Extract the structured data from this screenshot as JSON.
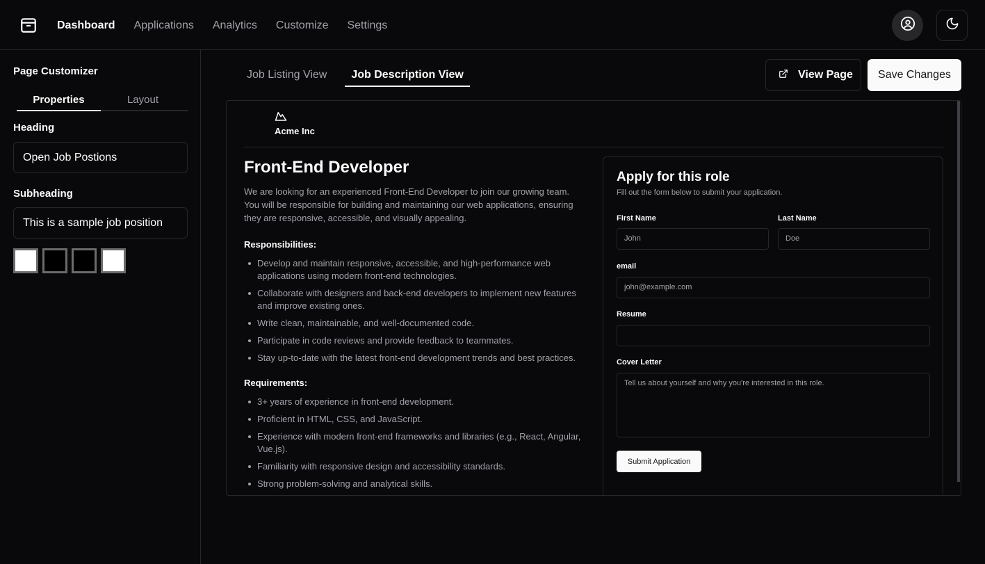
{
  "nav": {
    "items": [
      {
        "label": "Dashboard",
        "active": true
      },
      {
        "label": "Applications",
        "active": false
      },
      {
        "label": "Analytics",
        "active": false
      },
      {
        "label": "Customize",
        "active": false
      },
      {
        "label": "Settings",
        "active": false
      }
    ],
    "icons": {
      "logo": "package-icon",
      "user": "user-circle-icon",
      "theme": "moon-icon"
    }
  },
  "sidebar": {
    "title": "Page Customizer",
    "tabs": [
      "Properties",
      "Layout"
    ],
    "heading_label": "Heading",
    "heading_value": "Open Job Postions",
    "subheading_label": "Subheading",
    "subheading_value": "This is a sample job position",
    "swatches": [
      "#ffffff",
      "#000000",
      "#000000",
      "#ffffff"
    ]
  },
  "main": {
    "view_tabs": [
      "Job Listing View",
      "Job Description View"
    ],
    "view_page_label": "View Page",
    "save_label": "Save Changes"
  },
  "preview": {
    "company": "Acme Inc",
    "job_title": "Front-End Developer",
    "job_description": "We are looking for an experienced Front-End Developer to join our growing team. You will be responsible for building and maintaining our web applications, ensuring they are responsive, accessible, and visually appealing.",
    "responsibilities_heading": "Responsibilities:",
    "responsibilities": [
      "Develop and maintain responsive, accessible, and high-performance web applications using modern front-end technologies.",
      "Collaborate with designers and back-end developers to implement new features and improve existing ones.",
      "Write clean, maintainable, and well-documented code.",
      "Participate in code reviews and provide feedback to teammates.",
      "Stay up-to-date with the latest front-end development trends and best practices."
    ],
    "requirements_heading": "Requirements:",
    "requirements": [
      "3+ years of experience in front-end development.",
      "Proficient in HTML, CSS, and JavaScript.",
      "Experience with modern front-end frameworks and libraries (e.g., React, Angular, Vue.js).",
      "Familiarity with responsive design and accessibility standards.",
      "Strong problem-solving and analytical skills."
    ],
    "form": {
      "title": "Apply for this role",
      "subtitle": "Fill out the form below to submit your application.",
      "first_name_label": "First Name",
      "first_name_placeholder": "John",
      "last_name_label": "Last Name",
      "last_name_placeholder": "Doe",
      "email_label": "email",
      "email_placeholder": "john@example.com",
      "resume_label": "Resume",
      "cover_label": "Cover Letter",
      "cover_placeholder": "Tell us about yourself and why you're interested in this role.",
      "submit_label": "Submit Application"
    }
  }
}
